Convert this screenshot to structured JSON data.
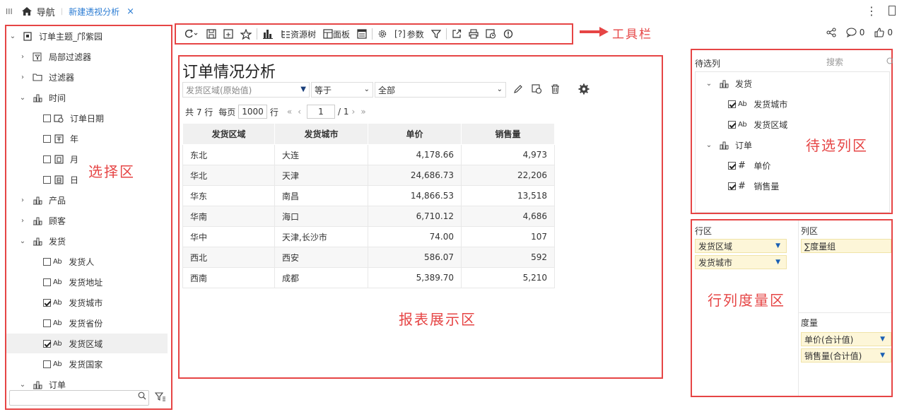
{
  "topbar": {
    "home_label": "导航",
    "active_tab": "新建透视分析",
    "close_glyph": "×",
    "more_glyph": "⋮"
  },
  "left_tree": {
    "root": "订单主题_邝紫园",
    "items": [
      {
        "label": "局部过滤器",
        "icon": "local-filter-icon"
      },
      {
        "label": "过滤器",
        "icon": "folder-icon"
      },
      {
        "label": "时间",
        "icon": "dimension-icon"
      },
      {
        "label": "订单日期",
        "icon": "calendar-clock-icon"
      },
      {
        "label": "年",
        "icon": "year-icon"
      },
      {
        "label": "月",
        "icon": "month-icon"
      },
      {
        "label": "日",
        "icon": "day-icon"
      },
      {
        "label": "产品",
        "icon": "dimension-icon"
      },
      {
        "label": "顾客",
        "icon": "dimension-icon"
      },
      {
        "label": "发货",
        "icon": "dimension-icon"
      },
      {
        "label": "发货人",
        "checked": false
      },
      {
        "label": "发货地址",
        "checked": false
      },
      {
        "label": "发货城市",
        "checked": true
      },
      {
        "label": "发货省份",
        "checked": false
      },
      {
        "label": "发货区域",
        "checked": true
      },
      {
        "label": "发货国家",
        "checked": false
      },
      {
        "label": "订单",
        "icon": "dimension-icon"
      }
    ],
    "ab_text": "Ab",
    "annotation": "选择区"
  },
  "toolbar": {
    "resource_tree": "资源树",
    "panel": "面板",
    "param_prefix": "[?]",
    "params": "参数",
    "annotation": "工具栏"
  },
  "header_right": {
    "comment_count": "0",
    "like_count": "0"
  },
  "report": {
    "title": "订单情况分析",
    "filter": {
      "field": "发货区域(原始值)",
      "operator": "等于",
      "value": "全部"
    },
    "pager": {
      "total": "共 7 行",
      "per_page_label": "每页",
      "per_page": "1000",
      "row_unit": "行",
      "current_page": "1",
      "total_pages": "/ 1"
    },
    "columns": [
      "发货区域",
      "发货城市",
      "单价",
      "销售量"
    ],
    "rows": [
      [
        "东北",
        "大连",
        "4,178.66",
        "4,973"
      ],
      [
        "华北",
        "天津",
        "24,686.73",
        "22,206"
      ],
      [
        "华东",
        "南昌",
        "14,866.53",
        "13,518"
      ],
      [
        "华南",
        "海口",
        "6,710.12",
        "4,686"
      ],
      [
        "华中",
        "天津,长沙市",
        "74.00",
        "107"
      ],
      [
        "西北",
        "西安",
        "586.07",
        "592"
      ],
      [
        "西南",
        "成都",
        "5,389.70",
        "5,210"
      ]
    ],
    "annotation": "报表展示区"
  },
  "pending": {
    "header": "待选列",
    "search": "搜索",
    "groups": [
      {
        "label": "发货",
        "items": [
          {
            "label": "发货城市",
            "kind": "Ab"
          },
          {
            "label": "发货区域",
            "kind": "Ab"
          }
        ]
      },
      {
        "label": "订单",
        "items": [
          {
            "label": "单价",
            "kind": "#"
          },
          {
            "label": "销售量",
            "kind": "#"
          }
        ]
      }
    ],
    "annotation": "待选列区"
  },
  "layout_zone": {
    "rows_label": "行区",
    "cols_label": "列区",
    "row_fields": [
      "发货区域",
      "发货城市"
    ],
    "col_fields": [
      "∑度量组"
    ],
    "measure_label": "度量",
    "measures": [
      "单价(合计值)",
      "销售量(合计值)"
    ],
    "annotation": "行列度量区"
  },
  "colors": {
    "annotation_red": "#e64545",
    "link_blue": "#2b7cd3",
    "pill_yellow": "#fdf6d8"
  }
}
